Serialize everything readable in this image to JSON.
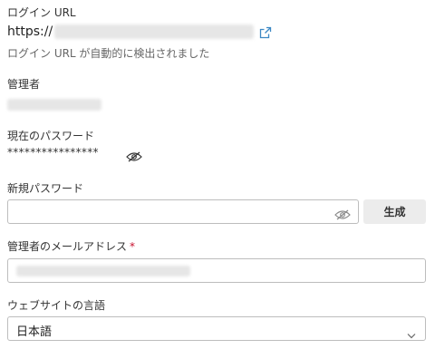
{
  "login_url": {
    "label": "ログイン URL",
    "value_prefix": "https://",
    "hint": "ログイン URL が自動的に検出されました",
    "icon": "external-link-icon"
  },
  "admin": {
    "label": "管理者"
  },
  "current_password": {
    "label": "現在のパスワード",
    "masked_value": "****************",
    "icon": "eye-slash-icon"
  },
  "new_password": {
    "label": "新規パスワード",
    "value": "",
    "icon": "eye-slash-icon",
    "generate_label": "生成"
  },
  "admin_email": {
    "label": "管理者のメールアドレス",
    "required_marker": "*"
  },
  "site_language": {
    "label": "ウェブサイトの言語",
    "selected": "日本語",
    "icon": "chevron-down-icon"
  },
  "colors": {
    "accent_link": "#3c88c4",
    "required": "#c8102e",
    "border": "#bdbdbd",
    "button_bg": "#ececec"
  }
}
